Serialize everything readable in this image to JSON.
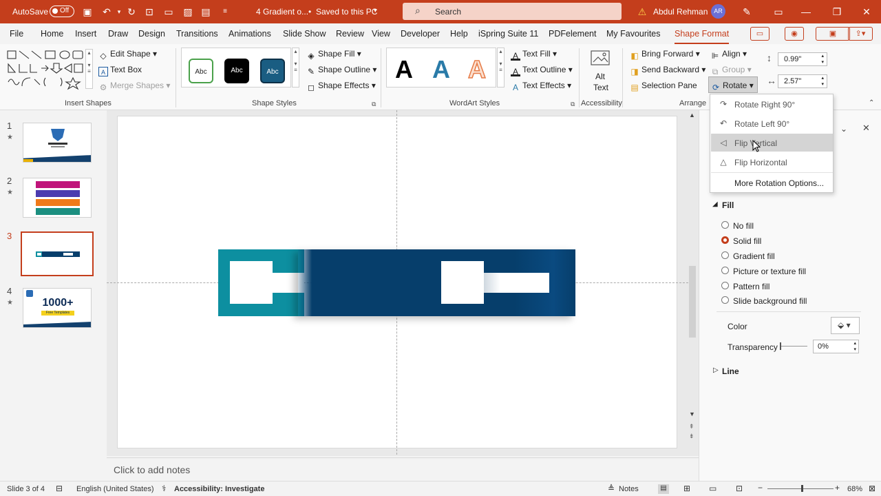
{
  "titlebar": {
    "autosave_label": "AutoSave",
    "autosave_state": "Off",
    "document": "4 Gradient o...",
    "saved_status": "Saved to this PC",
    "search_placeholder": "Search",
    "user_name": "Abdul Rehman",
    "user_initials": "AR"
  },
  "tabs": [
    "File",
    "Home",
    "Insert",
    "Draw",
    "Design",
    "Transitions",
    "Animations",
    "Slide Show",
    "Review",
    "View",
    "Developer",
    "Help",
    "iSpring Suite 11",
    "PDFelement",
    "My Favourites",
    "Shape Format"
  ],
  "active_tab": "Shape Format",
  "ribbon": {
    "insert_shapes": {
      "edit_shape": "Edit Shape",
      "text_box": "Text Box",
      "merge_shapes": "Merge Shapes",
      "label": "Insert Shapes"
    },
    "shape_styles": {
      "swatches": [
        "Abc",
        "Abc",
        "Abc"
      ],
      "fill": "Shape Fill",
      "outline": "Shape Outline",
      "effects": "Shape Effects",
      "label": "Shape Styles"
    },
    "wordart": {
      "letters": [
        "A",
        "A",
        "A"
      ],
      "text_fill": "Text Fill",
      "text_outline": "Text Outline",
      "text_effects": "Text Effects",
      "label": "WordArt Styles"
    },
    "accessibility": {
      "alt_text_1": "Alt",
      "alt_text_2": "Text",
      "label": "Accessibility"
    },
    "arrange": {
      "bring_forward": "Bring Forward",
      "send_backward": "Send Backward",
      "selection_pane": "Selection Pane",
      "align": "Align",
      "group": "Group",
      "rotate": "Rotate",
      "label": "Arrange"
    },
    "size": {
      "height": "0.99\"",
      "width": "2.57\""
    }
  },
  "rotate_menu": {
    "items": [
      "Rotate Right 90°",
      "Rotate Left 90°",
      "Flip Vertical",
      "Flip Horizontal",
      "More Rotation Options..."
    ],
    "highlighted": "Flip Vertical"
  },
  "slides": [
    {
      "num": "1",
      "star": "★"
    },
    {
      "num": "2",
      "star": "★"
    },
    {
      "num": "3"
    },
    {
      "num": "4",
      "star": "★"
    }
  ],
  "thumb4_text": {
    "big": "1000+",
    "sub": "Free Templates"
  },
  "notes_placeholder": "Click to add notes",
  "format_pane": {
    "fill_header": "Fill",
    "options": [
      "No fill",
      "Solid fill",
      "Gradient fill",
      "Picture or texture fill",
      "Pattern fill",
      "Slide background fill"
    ],
    "selected": "Solid fill",
    "color_label": "Color",
    "transparency_label": "Transparency",
    "transparency_value": "0%",
    "line_header": "Line"
  },
  "status": {
    "slide_info": "Slide 3 of 4",
    "language": "English (United States)",
    "accessibility": "Accessibility: Investigate",
    "notes": "Notes",
    "zoom": "68%"
  },
  "colors": {
    "accent": "#c43e1c",
    "teal": "#0d8fa0",
    "navy": "#063e6b"
  }
}
